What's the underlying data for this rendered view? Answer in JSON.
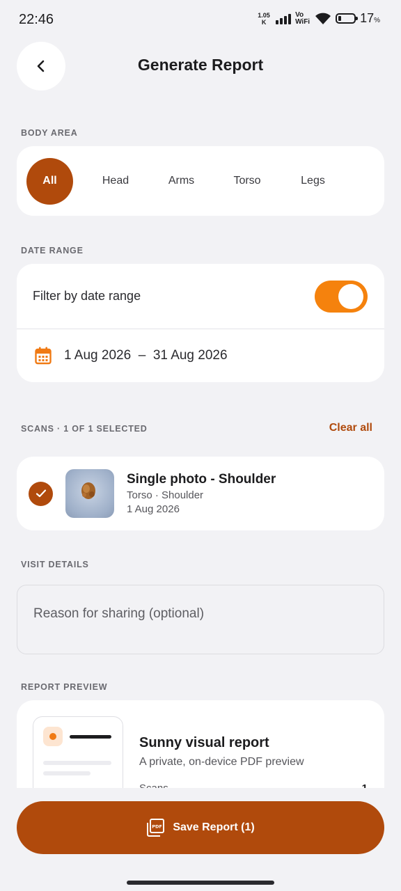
{
  "status_bar": {
    "time": "22:46",
    "net_speed_value": "1.05",
    "net_speed_unit": "K",
    "vowifi_top": "Vo",
    "vowifi_bottom": "WiFi",
    "battery": "17",
    "battery_unit": "%"
  },
  "header": {
    "title": "Generate Report"
  },
  "body_area": {
    "label": "BODY AREA",
    "chips": [
      {
        "label": "All",
        "selected": true
      },
      {
        "label": "Head",
        "selected": false
      },
      {
        "label": "Arms",
        "selected": false
      },
      {
        "label": "Torso",
        "selected": false
      },
      {
        "label": "Legs",
        "selected": false
      }
    ]
  },
  "date_range": {
    "label": "DATE RANGE",
    "toggle_label": "Filter by date range",
    "toggle_on": true,
    "range_text": "1 Aug 2026  –  31 Aug 2026"
  },
  "scans": {
    "label": "SCANS · 1 OF 1 SELECTED",
    "clear_all": "Clear all",
    "items": [
      {
        "title": "Single photo - Shoulder",
        "subtitle": "Torso · Shoulder",
        "date": "1 Aug 2026",
        "checked": true
      }
    ]
  },
  "visit_details": {
    "label": "VISIT DETAILS",
    "reason_placeholder": "Reason for sharing (optional)"
  },
  "report_preview": {
    "label": "REPORT PREVIEW",
    "title": "Sunny visual report",
    "subtitle": "A private, on-device PDF preview",
    "row_label": "Scans",
    "row_value": "1"
  },
  "save_button": {
    "label": "Save Report (1)"
  },
  "colors": {
    "accent": "#b04a0c",
    "toggle": "#f5820d",
    "background": "#f2f2f5"
  }
}
